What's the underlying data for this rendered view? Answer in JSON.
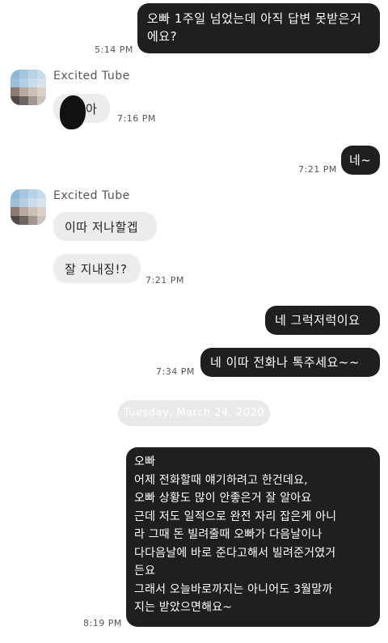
{
  "chat": {
    "contact_name": "Excited Tube",
    "messages": [
      {
        "text": "오빠 1주일 넘었는데 아직 답변 못받은거\n에요?",
        "time": "5:14 PM"
      },
      {
        "text": "아",
        "time": "7:16 PM"
      },
      {
        "text": "네~",
        "time": "7:21 PM"
      },
      {
        "text": "이따 저나할겝",
        "time": ""
      },
      {
        "text": "잘 지내징!?",
        "time": "7:21 PM"
      },
      {
        "text": "네 그럭저럭이요~",
        "time": ""
      },
      {
        "text": "네 이따 전화나 톡주세요~~",
        "time": "7:34 PM"
      },
      {
        "text": "오빠\n어제 전화할때 얘기하려고 한건데요,\n오빠 상황도 많이 안좋은거 잘 알아요\n근데 저도 일적으로 완전 자리 잡은게 아니\n라 그때 돈 빌려줄때 오빠가 다음날이나\n다다음날에 바로 준다고해서 빌려준거였거\n든요\n그래서 오늘바로까지는 아니어도 3월말까\n지는 받았으면해요~",
        "time": "8:19 PM"
      }
    ],
    "date_separator": "Tuesday, March 24, 2020"
  },
  "colors": {
    "outgoing_bubble": "#1f1f1f",
    "incoming_bubble": "#ececec",
    "date_pill": "#e9e9e9"
  }
}
